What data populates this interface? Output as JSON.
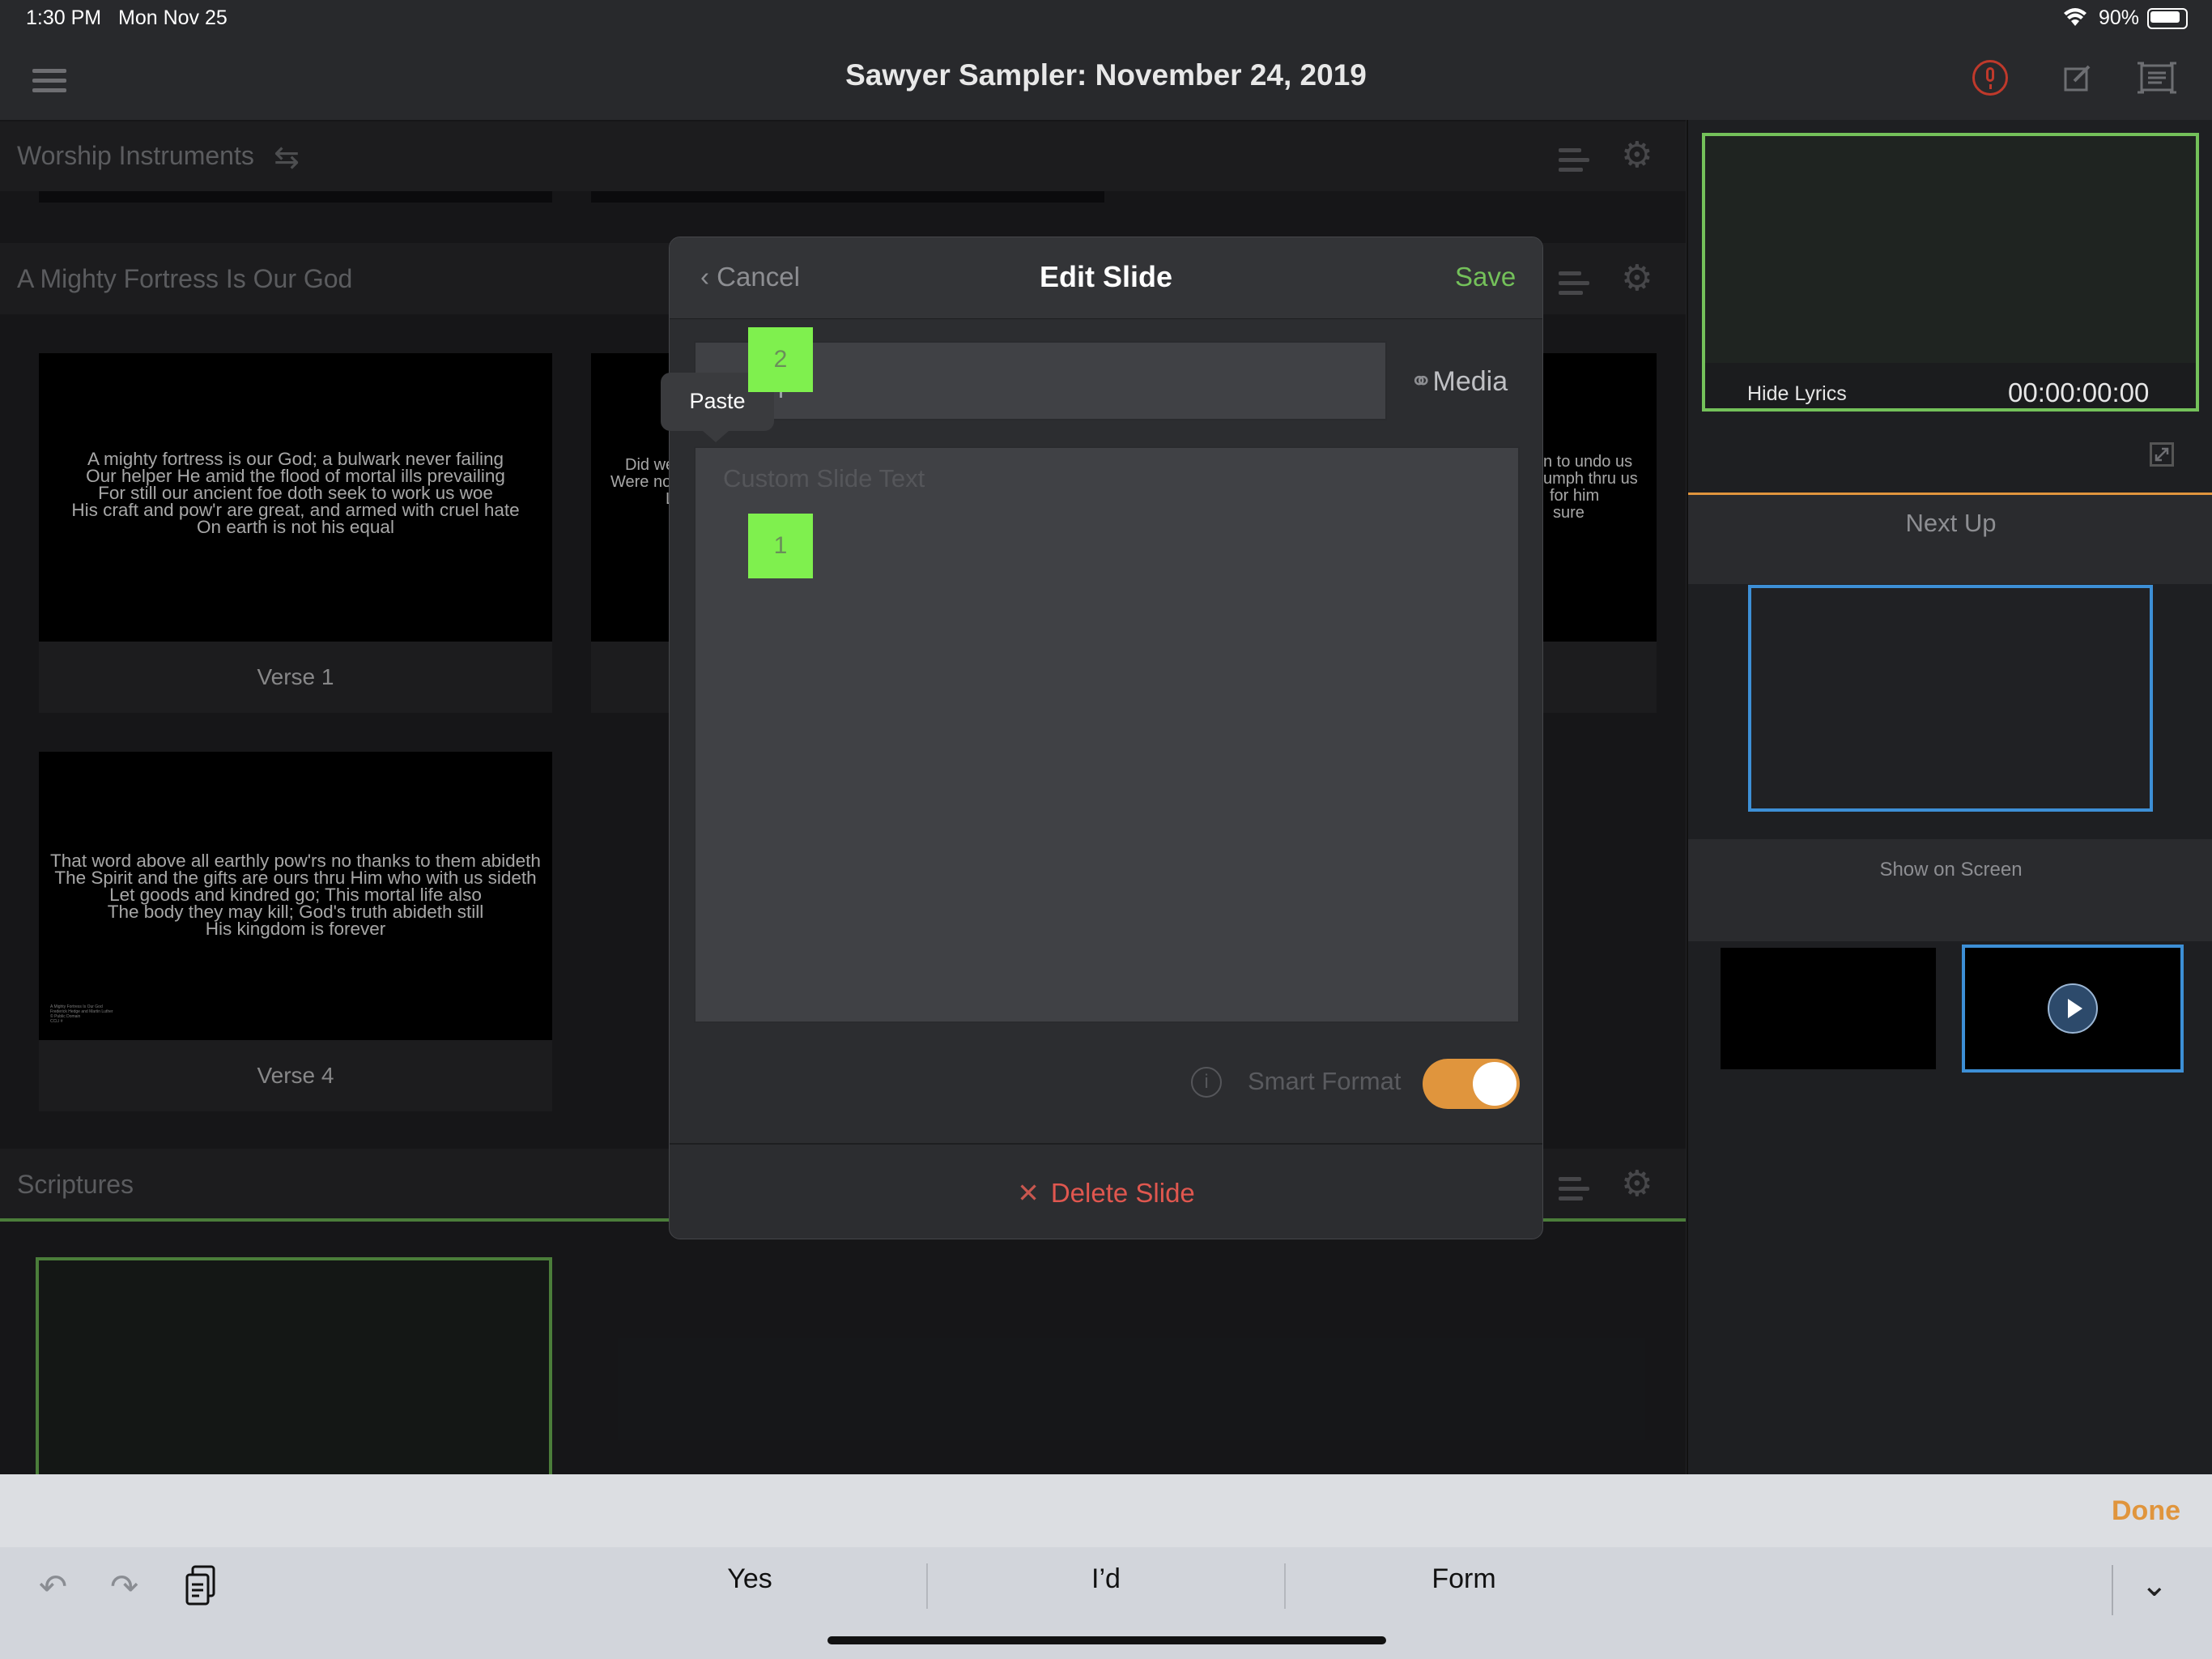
{
  "status_bar": {
    "time": "1:30 PM",
    "date": "Mon Nov 25",
    "battery": "90%"
  },
  "header": {
    "title": "Sawyer Sampler: November 24, 2019",
    "icons": [
      "menu-icon",
      "microphone-icon",
      "edit-icon",
      "present-icon"
    ],
    "mic_color": "#c0392b"
  },
  "sections": {
    "worship": {
      "title": "Worship Instruments"
    },
    "fortress": {
      "title": "A Mighty Fortress Is Our God"
    },
    "scriptures": {
      "title": "Scriptures"
    }
  },
  "slides": [
    {
      "label": "Verse 1",
      "lines": [
        "A mighty fortress is our God; a bulwark never failing",
        "Our helper He amid the flood of mortal ills prevailing",
        "For still our ancient foe doth seek to work us woe",
        "His craft and pow'r are great, and armed with cruel hate",
        "On earth is not his equal"
      ]
    },
    {
      "label": "Verse 4",
      "lines": [
        "That word above all earthly pow'rs no thanks to them abideth",
        "The Spirit and the gifts are ours thru Him who with us sideth",
        "Let goods and kindred go; This mortal life also",
        "The body they may kill; God's truth abideth still",
        "His kingdom is forever"
      ],
      "credits": [
        "A Mighty Fortress Is Our God",
        "Frederick Hedge and Martin Luther",
        "© Public Domain",
        "CCLI #"
      ]
    }
  ],
  "partial_slide_left": [
    "Did we",
    "Were no",
    "L"
  ],
  "partial_slide_right": [
    "n to undo us",
    "umph thru us",
    "for him",
    "sure"
  ],
  "right_panel": {
    "hide_lyrics": "Hide Lyrics",
    "timecode": "00:00:00:00",
    "next_up": "Next Up",
    "show_on_screen": "Show on Screen",
    "accent_green": "#74c15a",
    "accent_blue": "#3d8fd6",
    "accent_orange": "#e0953d"
  },
  "modal": {
    "cancel": "Cancel",
    "title": "Edit Slide",
    "save": "Save",
    "media": "Media",
    "paste": "Paste",
    "text_placeholder": "Custom Slide Text",
    "smart_format": "Smart Format",
    "smart_format_on": true,
    "delete": "Delete Slide",
    "badge1": "1",
    "badge2": "2"
  },
  "keyboard": {
    "done": "Done",
    "suggestions": [
      "Yes",
      "I’d",
      "Form"
    ]
  }
}
